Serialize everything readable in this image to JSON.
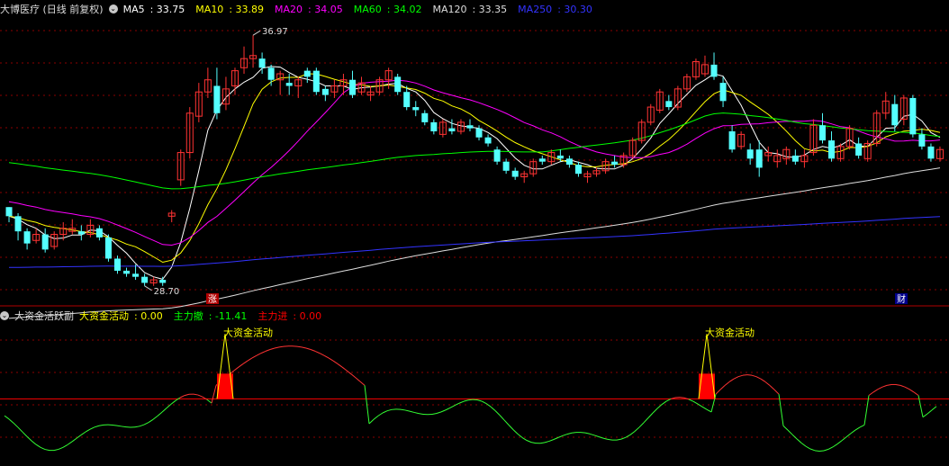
{
  "main_panel": {
    "title": "大博医疗 (日线 前复权)",
    "indicators": [
      {
        "label": "MA5",
        "value": "33.75",
        "color": "#ffffff"
      },
      {
        "label": "MA10",
        "value": "33.89",
        "color": "#ffff00"
      },
      {
        "label": "MA20",
        "value": "34.05",
        "color": "#ff00ff"
      },
      {
        "label": "MA60",
        "value": "34.02",
        "color": "#00ff00"
      },
      {
        "label": "MA120",
        "value": "33.35",
        "color": "#dddddd"
      },
      {
        "label": "MA250",
        "value": "30.30",
        "color": "#3333ff"
      }
    ],
    "high_label": "36.97",
    "low_label": "28.70",
    "marker_left": "涨",
    "marker_right": "财"
  },
  "sub_panel": {
    "title": "大资金活跃副",
    "indicators": [
      {
        "label": "大资金活动",
        "value": "0.00",
        "color": "#ffff00"
      },
      {
        "label": "主力撤",
        "value": "-11.41",
        "color": "#00ff00"
      },
      {
        "label": "主力进",
        "value": "0.00",
        "color": "#ff0000"
      }
    ],
    "signal_label": "大资金活动"
  },
  "colors": {
    "up": "#ff3333",
    "down": "#54ffff",
    "grid": "#8b0000",
    "divider": "#b00000"
  },
  "chart_data": {
    "type": "candlestick",
    "ohlc": [
      [
        31.3,
        31.3,
        30.8,
        31.0
      ],
      [
        31.0,
        31.1,
        30.2,
        30.5
      ],
      [
        30.5,
        30.6,
        29.9,
        30.1
      ],
      [
        30.2,
        30.6,
        30.1,
        30.4
      ],
      [
        30.4,
        30.6,
        29.8,
        29.9
      ],
      [
        30.0,
        30.5,
        29.9,
        30.4
      ],
      [
        30.4,
        30.8,
        30.2,
        30.6
      ],
      [
        30.5,
        30.9,
        30.4,
        30.6
      ],
      [
        30.5,
        30.7,
        30.2,
        30.4
      ],
      [
        30.4,
        30.9,
        30.3,
        30.7
      ],
      [
        30.6,
        30.7,
        30.2,
        30.3
      ],
      [
        30.3,
        30.4,
        29.5,
        29.6
      ],
      [
        29.6,
        29.7,
        29.1,
        29.2
      ],
      [
        29.2,
        29.3,
        29.0,
        29.1
      ],
      [
        29.1,
        29.4,
        28.9,
        29.0
      ],
      [
        29.0,
        29.1,
        28.7,
        28.8
      ],
      [
        28.8,
        29.0,
        28.7,
        28.9
      ],
      [
        28.9,
        29.0,
        28.7,
        28.8
      ],
      [
        31.0,
        31.2,
        30.8,
        31.1
      ],
      [
        32.2,
        33.2,
        32.0,
        33.1
      ],
      [
        33.1,
        34.6,
        32.9,
        34.4
      ],
      [
        34.3,
        35.4,
        34.1,
        35.1
      ],
      [
        35.1,
        35.9,
        34.9,
        35.5
      ],
      [
        35.3,
        35.9,
        34.2,
        34.4
      ],
      [
        34.7,
        35.6,
        34.5,
        35.2
      ],
      [
        35.3,
        35.9,
        35.0,
        35.8
      ],
      [
        35.9,
        36.6,
        35.7,
        36.2
      ],
      [
        36.2,
        36.97,
        35.9,
        36.3
      ],
      [
        36.2,
        36.4,
        35.7,
        35.9
      ],
      [
        35.9,
        36.0,
        35.3,
        35.5
      ],
      [
        35.5,
        35.8,
        35.0,
        35.7
      ],
      [
        35.4,
        35.7,
        35.0,
        35.3
      ],
      [
        35.3,
        35.6,
        34.9,
        35.5
      ],
      [
        35.8,
        35.9,
        35.4,
        35.6
      ],
      [
        35.8,
        35.9,
        35.0,
        35.1
      ],
      [
        35.2,
        35.3,
        34.8,
        35.0
      ],
      [
        35.1,
        35.5,
        34.9,
        35.3
      ],
      [
        35.3,
        35.7,
        35.0,
        35.5
      ],
      [
        35.5,
        35.8,
        34.9,
        35.0
      ],
      [
        35.1,
        35.6,
        35.0,
        35.4
      ],
      [
        35.0,
        35.3,
        34.8,
        35.1
      ],
      [
        35.1,
        35.6,
        35.0,
        35.5
      ],
      [
        35.5,
        35.9,
        35.2,
        35.8
      ],
      [
        35.6,
        35.7,
        35.0,
        35.1
      ],
      [
        35.1,
        35.3,
        34.5,
        34.6
      ],
      [
        34.6,
        34.8,
        34.3,
        34.5
      ],
      [
        34.4,
        34.5,
        34.0,
        34.1
      ],
      [
        34.1,
        34.2,
        33.7,
        33.8
      ],
      [
        33.7,
        34.2,
        33.6,
        34.1
      ],
      [
        33.9,
        34.2,
        33.7,
        33.8
      ],
      [
        33.8,
        34.2,
        33.7,
        34.1
      ],
      [
        34.0,
        34.2,
        33.8,
        33.9
      ],
      [
        33.9,
        34.0,
        33.5,
        33.6
      ],
      [
        33.6,
        33.7,
        33.3,
        33.4
      ],
      [
        33.2,
        33.3,
        32.7,
        32.8
      ],
      [
        32.8,
        32.9,
        32.4,
        32.5
      ],
      [
        32.5,
        32.6,
        32.2,
        32.3
      ],
      [
        32.3,
        32.5,
        32.1,
        32.4
      ],
      [
        32.4,
        32.9,
        32.3,
        32.8
      ],
      [
        32.9,
        33.0,
        32.7,
        32.8
      ],
      [
        32.8,
        33.2,
        32.7,
        33.1
      ],
      [
        33.0,
        33.2,
        32.8,
        32.9
      ],
      [
        32.9,
        33.0,
        32.6,
        32.7
      ],
      [
        32.7,
        32.8,
        32.3,
        32.4
      ],
      [
        32.3,
        32.5,
        32.1,
        32.4
      ],
      [
        32.4,
        32.6,
        32.3,
        32.5
      ],
      [
        32.5,
        32.9,
        32.4,
        32.8
      ],
      [
        32.8,
        33.0,
        32.6,
        32.7
      ],
      [
        32.7,
        33.1,
        32.6,
        33.0
      ],
      [
        33.0,
        33.6,
        32.9,
        33.5
      ],
      [
        33.5,
        34.2,
        33.4,
        34.1
      ],
      [
        34.1,
        34.7,
        34.0,
        34.6
      ],
      [
        34.5,
        35.2,
        34.4,
        35.1
      ],
      [
        34.8,
        35.0,
        34.5,
        34.6
      ],
      [
        34.6,
        35.3,
        34.5,
        35.2
      ],
      [
        35.2,
        35.7,
        35.1,
        35.6
      ],
      [
        35.6,
        36.2,
        35.5,
        36.1
      ],
      [
        35.7,
        36.3,
        35.6,
        36.0
      ],
      [
        36.0,
        36.4,
        35.5,
        35.6
      ],
      [
        35.4,
        35.6,
        34.6,
        34.8
      ],
      [
        33.8,
        34.0,
        33.1,
        33.2
      ],
      [
        33.3,
        33.8,
        33.2,
        33.7
      ],
      [
        33.2,
        33.4,
        32.7,
        32.9
      ],
      [
        33.2,
        33.5,
        32.3,
        32.6
      ],
      [
        33.0,
        33.3,
        32.8,
        33.1
      ],
      [
        32.8,
        33.2,
        32.6,
        33.0
      ],
      [
        32.9,
        33.3,
        32.7,
        33.2
      ],
      [
        33.0,
        33.2,
        32.7,
        32.8
      ],
      [
        32.8,
        33.2,
        32.6,
        33.0
      ],
      [
        33.1,
        34.2,
        33.0,
        34.0
      ],
      [
        34.0,
        34.4,
        33.4,
        33.5
      ],
      [
        33.5,
        33.8,
        32.8,
        32.9
      ],
      [
        32.9,
        33.4,
        32.8,
        33.3
      ],
      [
        33.3,
        34.0,
        33.2,
        33.9
      ],
      [
        33.4,
        33.6,
        32.9,
        33.0
      ],
      [
        32.9,
        33.5,
        32.8,
        33.4
      ],
      [
        33.4,
        34.5,
        33.3,
        34.4
      ],
      [
        34.4,
        35.1,
        34.2,
        34.8
      ],
      [
        34.7,
        35.0,
        33.8,
        34.0
      ],
      [
        34.2,
        35.0,
        34.0,
        34.9
      ],
      [
        34.9,
        35.0,
        33.6,
        33.7
      ],
      [
        33.7,
        33.9,
        33.2,
        33.3
      ],
      [
        33.3,
        33.4,
        32.8,
        32.9
      ],
      [
        32.9,
        33.3,
        32.8,
        33.2
      ]
    ],
    "ylim": [
      28.1,
      37.6
    ],
    "sub_ylim": [
      -14,
      16
    ]
  }
}
